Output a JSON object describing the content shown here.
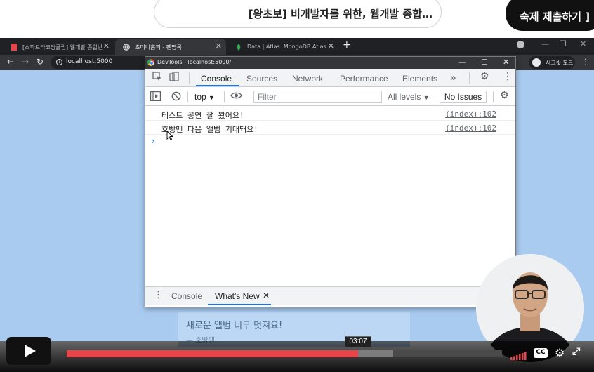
{
  "lecture": {
    "title": "[왕초보] 비개발자를 위한, 웹개발 종합…",
    "submit_label": "숙제 제출하기 ]"
  },
  "browser": {
    "tabs": [
      {
        "label": "[스파르타코딩클럽] 웹개발 종합반",
        "favicon": "bookmark-icon",
        "active": false
      },
      {
        "label": "초미니홈피 - 팬명록",
        "favicon": "globe-icon",
        "active": true
      },
      {
        "label": "Data | Atlas: MongoDB Atlas",
        "favicon": "mongodb-leaf-icon",
        "active": false
      }
    ],
    "new_tab_glyph": "+",
    "url": "localhost:5000",
    "profile_label": "시크릿 모드"
  },
  "devtools": {
    "window_title": "DevTools - localhost:5000/",
    "tabs": [
      "Console",
      "Sources",
      "Network",
      "Performance",
      "Elements"
    ],
    "active_tab": "Console",
    "more_tabs_glyph": "»",
    "context_select": "top",
    "filter_placeholder": "Filter",
    "levels_label": "All levels",
    "issues_label": "No Issues",
    "log": [
      {
        "message": "테스트 공연 잘 봤어요!",
        "source": "(index):102"
      },
      {
        "message": "호빵맨 다음 앨범 기대돼요!",
        "source": "(index):102"
      }
    ],
    "prompt_glyph": "›",
    "drawer_tabs": [
      "Console",
      "What's New"
    ],
    "drawer_active": "What's New"
  },
  "page": {
    "review_text": "새로운 앨범 너무 멋져요!",
    "review_author": "— 호빵맨"
  },
  "player": {
    "time_label": "03:07",
    "played_fraction": 0.67,
    "buffered_fraction": 0.75,
    "cc_label": "CC"
  },
  "colors": {
    "accent": "#1a73e8",
    "page_bg": "#a9cbf0",
    "progress_played": "#e8444a"
  }
}
